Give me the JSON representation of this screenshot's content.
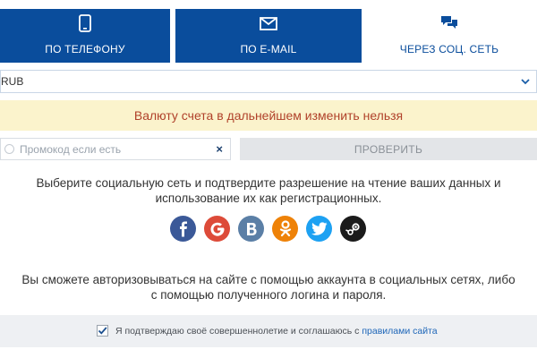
{
  "tabs": {
    "phone": {
      "label": "ПО ТЕЛЕФОНУ",
      "icon": "phone-icon"
    },
    "email": {
      "label": "ПО E-MAIL",
      "icon": "envelope-icon"
    },
    "social": {
      "label": "ЧЕРЕЗ СОЦ. СЕТЬ",
      "icon": "chat-icon",
      "active": true
    }
  },
  "currency": {
    "value": "RUB"
  },
  "warning": "Валюту счета в дальнейшем изменить нельзя",
  "promo": {
    "placeholder": "Промокод если есть",
    "clear": "×"
  },
  "check_button": "ПРОВЕРИТЬ",
  "intro": {
    "line1": "Выберите социальную сеть и подтвердите разрешение на чтение ваших данных и",
    "line2": "использование их как регистрационных."
  },
  "socials": [
    {
      "name": "facebook",
      "glyph": "f",
      "color": "#3b5998"
    },
    {
      "name": "google",
      "glyph": "G",
      "color": "#dd4b39"
    },
    {
      "name": "vkontakte",
      "glyph": "B",
      "color": "#5b7fa6"
    },
    {
      "name": "odnoklassniki",
      "glyph": "ок",
      "color": "#ee8208"
    },
    {
      "name": "twitter",
      "glyph": "t",
      "color": "#1da1f2"
    },
    {
      "name": "steam",
      "glyph": "s",
      "color": "#1b1b1b"
    }
  ],
  "note": {
    "line1": "Вы сможете авторизовываться на сайте с помощью аккаунта в социальных сетях, либо",
    "line2": "с помощью полученного логина и пароля."
  },
  "agreement": {
    "checked": true,
    "text": "Я подтверждаю своё совершеннолетие и соглашаюсь с ",
    "link": "правилами сайта"
  },
  "colors": {
    "tab_active_bg": "#0a4d9c",
    "warning_bg": "#fbf3cc",
    "warning_text": "#b0412a",
    "link": "#1e66b8"
  }
}
